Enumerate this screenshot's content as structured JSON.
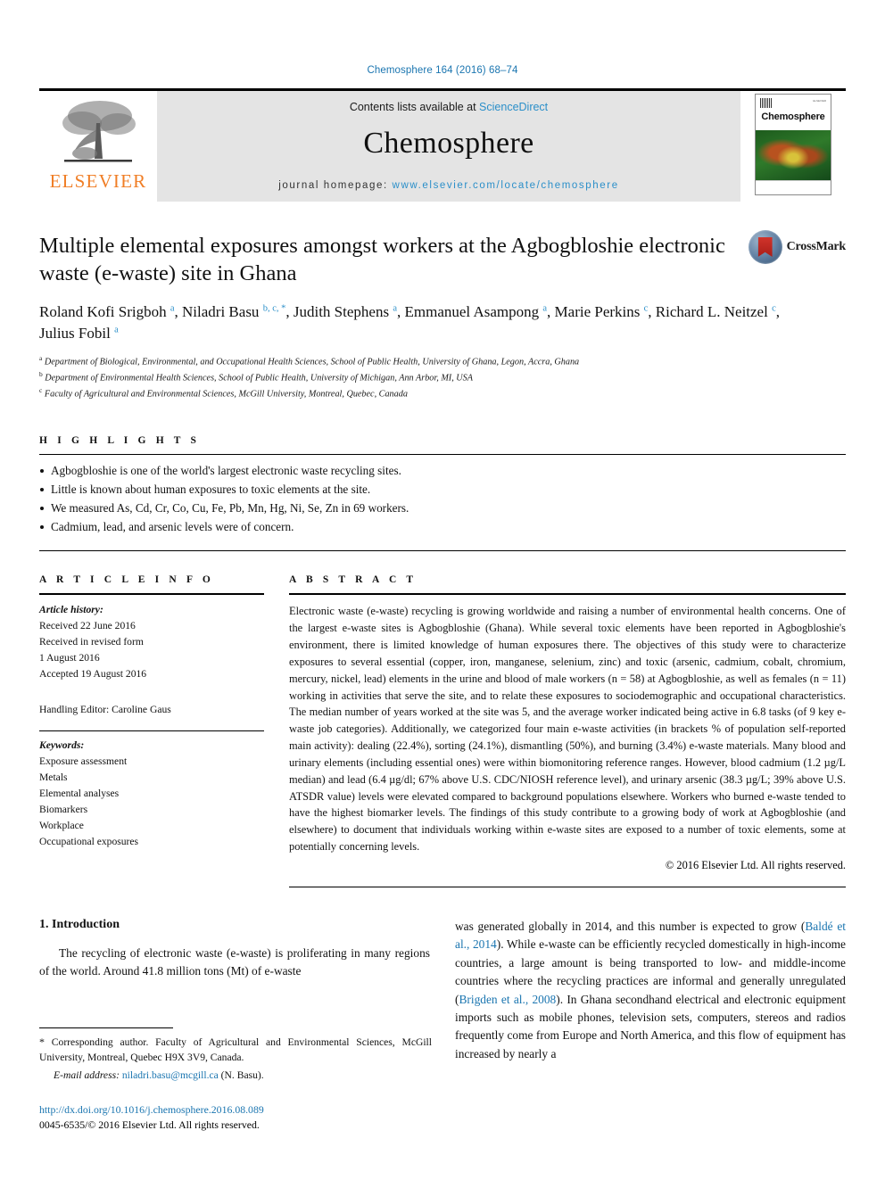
{
  "running_head": "Chemosphere 164 (2016) 68–74",
  "masthead": {
    "publisher_logo_text": "ELSEVIER",
    "contents_prefix": "Contents lists available at ",
    "contents_link": "ScienceDirect",
    "journal_title": "Chemosphere",
    "homepage_label": "journal homepage:",
    "homepage_url": "www.elsevier.com/locate/chemosphere",
    "cover": {
      "journal_name": "Chemosphere",
      "corner_note": "ELSEVIER"
    }
  },
  "article": {
    "title": "Multiple elemental exposures amongst workers at the Agbogbloshie electronic waste (e-waste) site in Ghana",
    "crossmark_label": "CrossMark",
    "authors_line1": "Roland Kofi Srigboh",
    "authors": [
      {
        "name": "Roland Kofi Srigboh",
        "marks": "a"
      },
      {
        "name": "Niladri Basu",
        "marks": "b, c, *"
      },
      {
        "name": "Judith Stephens",
        "marks": "a"
      },
      {
        "name": "Emmanuel Asampong",
        "marks": "a"
      },
      {
        "name": "Marie Perkins",
        "marks": "c"
      },
      {
        "name": "Richard L. Neitzel",
        "marks": "c"
      },
      {
        "name": "Julius Fobil",
        "marks": "a"
      }
    ],
    "affiliations": [
      {
        "mark": "a",
        "text": "Department of Biological, Environmental, and Occupational Health Sciences, School of Public Health, University of Ghana, Legon, Accra, Ghana"
      },
      {
        "mark": "b",
        "text": "Department of Environmental Health Sciences, School of Public Health, University of Michigan, Ann Arbor, MI, USA"
      },
      {
        "mark": "c",
        "text": "Faculty of Agricultural and Environmental Sciences, McGill University, Montreal, Quebec, Canada"
      }
    ]
  },
  "highlights": {
    "heading": "H I G H L I G H T S",
    "items": [
      "Agbogbloshie is one of the world's largest electronic waste recycling sites.",
      "Little is known about human exposures to toxic elements at the site.",
      "We measured As, Cd, Cr, Co, Cu, Fe, Pb, Mn, Hg, Ni, Se, Zn in 69 workers.",
      "Cadmium, lead, and arsenic levels were of concern."
    ]
  },
  "article_info": {
    "heading": "A R T I C L E  I N F O",
    "history_label": "Article history:",
    "history_lines": [
      "Received 22 June 2016",
      "Received in revised form",
      "1 August 2016",
      "Accepted 19 August 2016"
    ],
    "handling_editor": "Handling Editor: Caroline Gaus",
    "keywords_label": "Keywords:",
    "keywords": [
      "Exposure assessment",
      "Metals",
      "Elemental analyses",
      "Biomarkers",
      "Workplace",
      "Occupational exposures"
    ]
  },
  "abstract": {
    "heading": "A B S T R A C T",
    "text": "Electronic waste (e-waste) recycling is growing worldwide and raising a number of environmental health concerns. One of the largest e-waste sites is Agbogbloshie (Ghana). While several toxic elements have been reported in Agbogbloshie's environment, there is limited knowledge of human exposures there. The objectives of this study were to characterize exposures to several essential (copper, iron, manganese, selenium, zinc) and toxic (arsenic, cadmium, cobalt, chromium, mercury, nickel, lead) elements in the urine and blood of male workers (n = 58) at Agbogbloshie, as well as females (n = 11) working in activities that serve the site, and to relate these exposures to sociodemographic and occupational characteristics. The median number of years worked at the site was 5, and the average worker indicated being active in 6.8 tasks (of 9 key e-waste job categories). Additionally, we categorized four main e-waste activities (in brackets % of population self-reported main activity): dealing (22.4%), sorting (24.1%), dismantling (50%), and burning (3.4%) e-waste materials. Many blood and urinary elements (including essential ones) were within biomonitoring reference ranges. However, blood cadmium (1.2 µg/L median) and lead (6.4 µg/dl; 67% above U.S. CDC/NIOSH reference level), and urinary arsenic (38.3 µg/L; 39% above U.S. ATSDR value) levels were elevated compared to background populations elsewhere. Workers who burned e-waste tended to have the highest biomarker levels. The findings of this study contribute to a growing body of work at Agbogbloshie (and elsewhere) to document that individuals working within e-waste sites are exposed to a number of toxic elements, some at potentially concerning levels.",
    "copyright": "© 2016 Elsevier Ltd. All rights reserved."
  },
  "body": {
    "section_number_title": "1. Introduction",
    "left_paragraph": "The recycling of electronic waste (e-waste) is proliferating in many regions of the world. Around 41.8 million tons (Mt) of e-waste",
    "right_paragraph_parts": [
      {
        "t": "was generated globally in 2014, and this number is expected to grow (",
        "link": false
      },
      {
        "t": "Baldé et al., 2014",
        "link": true
      },
      {
        "t": "). While e-waste can be efficiently recycled domestically in high-income countries, a large amount is being transported to low- and middle-income countries where the recycling practices are informal and generally unregulated (",
        "link": false
      },
      {
        "t": "Brigden et al., 2008",
        "link": true
      },
      {
        "t": "). In Ghana secondhand electrical and electronic equipment imports such as mobile phones, television sets, computers, stereos and radios frequently come from Europe and North America, and this flow of equipment has increased by nearly a",
        "link": false
      }
    ]
  },
  "footnote": {
    "corresponding_star": "*",
    "corresponding_text": " Corresponding author. Faculty of Agricultural and Environmental Sciences, McGill University, Montreal, Quebec H9X 3V9, Canada.",
    "email_label": "E-mail address:",
    "email": "niladri.basu@mcgill.ca",
    "email_suffix": " (N. Basu).",
    "doi_url": "http://dx.doi.org/10.1016/j.chemosphere.2016.08.089",
    "issn_line": "0045-6535/© 2016 Elsevier Ltd. All rights reserved."
  },
  "colors": {
    "link_blue": "#1a75b0",
    "elsevier_orange": "#f07e26",
    "sciencedirect_blue": "#2b8fc9"
  }
}
